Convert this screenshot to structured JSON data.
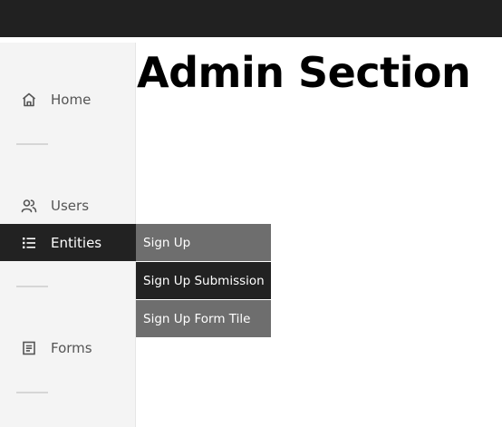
{
  "page": {
    "title": "Admin Section"
  },
  "sidebar": {
    "items": [
      {
        "label": "Home",
        "icon": "home-icon"
      },
      {
        "label": "Users",
        "icon": "users-icon"
      },
      {
        "label": "Entities",
        "icon": "list-icon",
        "active": true
      },
      {
        "label": "Forms",
        "icon": "form-icon"
      }
    ]
  },
  "submenu": {
    "items": [
      {
        "label": "Sign Up"
      },
      {
        "label": "Sign Up Submission"
      },
      {
        "label": "Sign Up Form Tile"
      }
    ]
  },
  "colors": {
    "topbar": "#212121",
    "sidebar_bg": "#f4f4f4",
    "active_bg": "#222222",
    "submenu_light": "#6e6e6e",
    "submenu_dark": "#222222"
  }
}
